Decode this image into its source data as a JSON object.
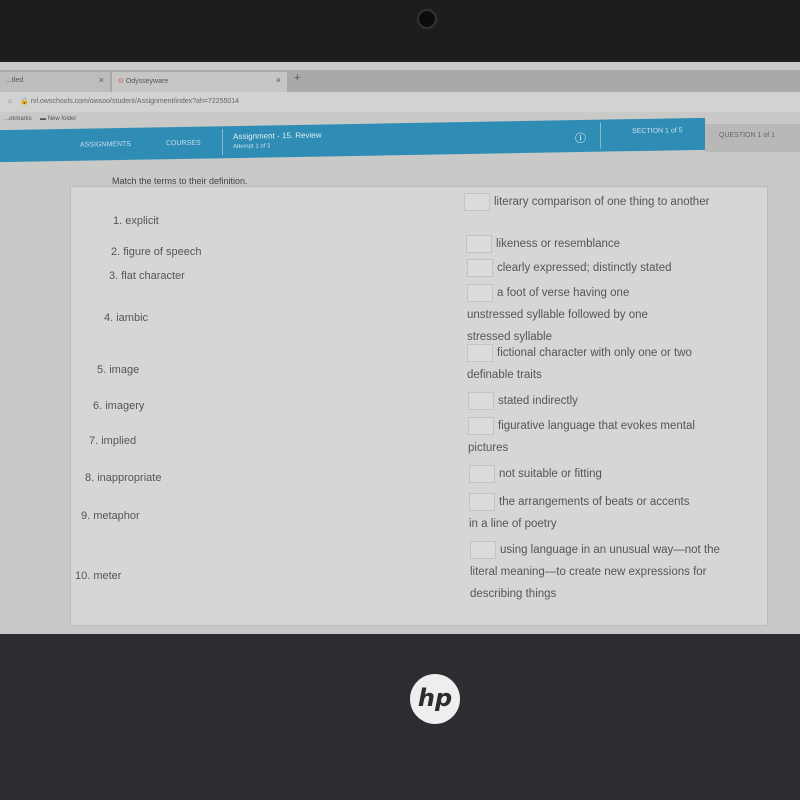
{
  "browser": {
    "tabs": [
      {
        "label": "...tled"
      },
      {
        "label": "Odysseyware"
      }
    ],
    "new_tab": "+",
    "url": "rvl.owschools.com/owsoo/student/Assignment/index?ah=72255014",
    "bookmarks": [
      "...okmarks",
      "New folder"
    ]
  },
  "nav": {
    "assignments": "ASSIGNMENTS",
    "courses": "COURSES",
    "title": "Assignment - 15. Review",
    "subtitle": "Attempt 1 of 3",
    "section": "SECTION 1 of 5",
    "question": "QUESTION 1 of 1",
    "accent": "#2f8db5"
  },
  "instruction": "Match the terms to their definition.",
  "terms": [
    "1. explicit",
    "2. figure of speech",
    "3. flat character",
    "4. iambic",
    "5. image",
    "6. imagery",
    "7. implied",
    "8. inappropriate",
    "9. metaphor",
    "10. meter"
  ],
  "definitions": [
    "literary comparison of one thing to another",
    "likeness or resemblance",
    "clearly expressed; distinctly stated",
    "a foot of verse having one unstressed syllable followed by one stressed syllable",
    "fictional character with only one or two definable traits",
    "stated indirectly",
    "figurative language that evokes mental pictures",
    "not suitable or fitting",
    "the arrangements of beats or accents in a line of poetry",
    "using language in an unusual way—not the literal meaning—to create new expressions for describing things"
  ],
  "logo": "hp"
}
